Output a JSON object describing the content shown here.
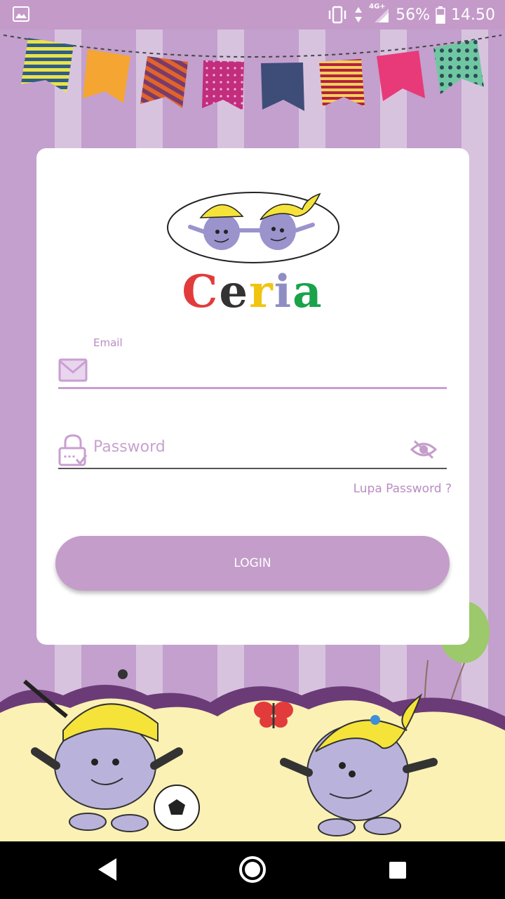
{
  "status_bar": {
    "battery": "56%",
    "time": "14.50",
    "network": "4G+",
    "icons": [
      "gallery-icon",
      "vibrate-icon",
      "data-arrows-icon",
      "signal-icon",
      "battery-icon"
    ]
  },
  "brand": {
    "name": [
      "C",
      "e",
      "r",
      "i",
      "a"
    ],
    "letter_colors": [
      "#e23b3b",
      "#333333",
      "#f1c40f",
      "#8e8ec4",
      "#1aa34a"
    ]
  },
  "login_form": {
    "email_label": "Email",
    "email_value": "",
    "email_icon": "mail-icon",
    "password_placeholder": "Password",
    "password_icon": "lock-icon",
    "visibility_icon": "eye-off-icon",
    "forgot_password": "Lupa Password ?",
    "login_button": "LOGIN"
  },
  "colors": {
    "accent": "#c49dca",
    "background": "#c4a0cd",
    "card": "#ffffff"
  },
  "nav_bar": {
    "icons": [
      "back-icon",
      "home-icon",
      "recents-icon"
    ]
  }
}
